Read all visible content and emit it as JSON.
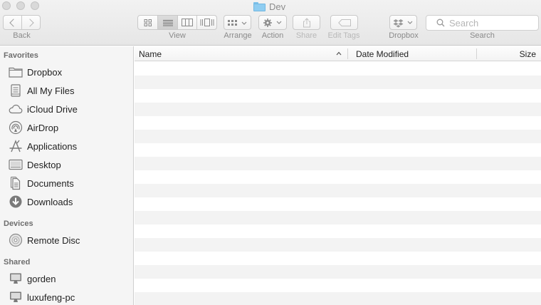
{
  "window": {
    "title": "Dev"
  },
  "toolbar": {
    "back_label": "Back",
    "view_label": "View",
    "arrange_label": "Arrange",
    "action_label": "Action",
    "share_label": "Share",
    "edit_tags_label": "Edit Tags",
    "dropbox_label": "Dropbox",
    "search_label": "Search",
    "search_placeholder": "Search",
    "active_view": "list"
  },
  "sidebar": {
    "favorites_title": "Favorites",
    "favorites": [
      {
        "label": "Dropbox",
        "icon": "folder-icon"
      },
      {
        "label": "All My Files",
        "icon": "all-files-icon"
      },
      {
        "label": "iCloud Drive",
        "icon": "cloud-icon"
      },
      {
        "label": "AirDrop",
        "icon": "airdrop-icon"
      },
      {
        "label": "Applications",
        "icon": "applications-icon"
      },
      {
        "label": "Desktop",
        "icon": "desktop-icon"
      },
      {
        "label": "Documents",
        "icon": "documents-icon"
      },
      {
        "label": "Downloads",
        "icon": "downloads-icon"
      }
    ],
    "devices_title": "Devices",
    "devices": [
      {
        "label": "Remote Disc",
        "icon": "disc-icon"
      }
    ],
    "shared_title": "Shared",
    "shared": [
      {
        "label": "gorden",
        "icon": "computer-icon"
      },
      {
        "label": "luxufeng-pc",
        "icon": "computer-icon"
      }
    ]
  },
  "file_list": {
    "columns": [
      "Name",
      "Date Modified",
      "Size"
    ],
    "sort_column": "Name",
    "sort_direction": "ascending",
    "rows": []
  },
  "colors": {
    "folder_accent": "#8fcdf1",
    "row_alternate": "#f3f3f3",
    "sidebar_bg": "#f5f5f5"
  }
}
